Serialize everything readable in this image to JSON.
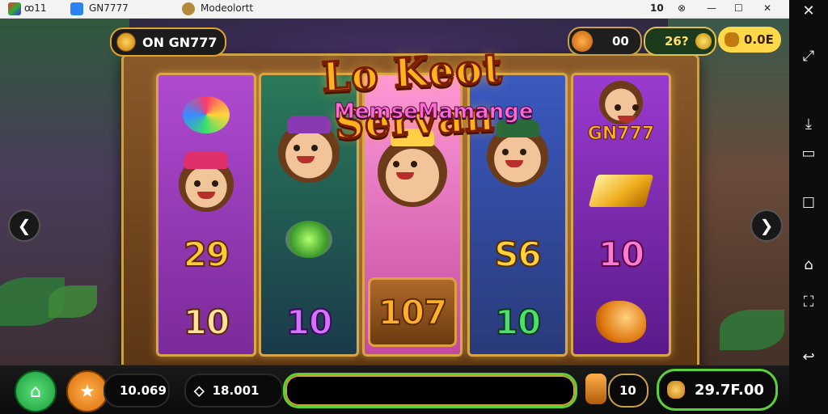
{
  "tabs": [
    {
      "label": "ꝏ11"
    },
    {
      "label": "GN7777"
    },
    {
      "label": "Modeolortt"
    }
  ],
  "window_controls": {
    "c1": "10",
    "c2": "⊗",
    "minimize": "—",
    "maximize": "☐",
    "close": "✕"
  },
  "sidebar_icons": [
    "close-icon",
    "expand-icon",
    "download-icon",
    "screen-icon",
    "square-icon",
    "home-icon",
    "shake-icon",
    "back-icon"
  ],
  "brand": {
    "label": "ON GN777"
  },
  "top_pills": {
    "a": "00",
    "b": "26?",
    "c": "0.0E"
  },
  "title": {
    "main": "Lo Keot Servan",
    "sub": "MemseMamange"
  },
  "reels": [
    {
      "symbols": [
        "",
        "",
        "29",
        "10"
      ]
    },
    {
      "symbols": [
        "",
        "",
        "10"
      ]
    },
    {
      "symbols": [
        "",
        "107"
      ]
    },
    {
      "symbols": [
        "",
        "S6",
        "10"
      ]
    },
    {
      "symbols": [
        "GN777",
        "",
        "10",
        ""
      ]
    }
  ],
  "bottom": {
    "balance": "10.069",
    "bet": "18.001",
    "lines": "10",
    "win": "29.7F.00"
  },
  "colors": {
    "accent": "#f1a41b",
    "green": "#34c759",
    "frame": "#7a4a1f"
  }
}
